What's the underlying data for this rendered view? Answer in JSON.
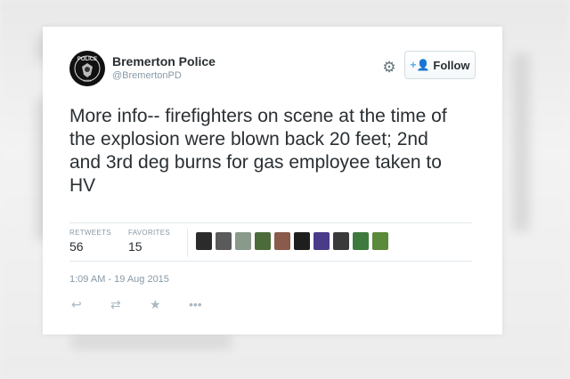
{
  "account": {
    "name": "Bremerton Police",
    "handle": "@BremertonPD",
    "avatar_icon": "police-badge-icon"
  },
  "header": {
    "settings_icon": "gear-icon",
    "follow_label": "Follow",
    "follow_icon": "add-user-icon"
  },
  "tweet": {
    "text": "More info-- firefighters on scene at the time of the explosion were blown back 20 feet; 2nd and 3rd deg burns for gas employee taken to HV",
    "timestamp": "1:09 AM - 19 Aug 2015"
  },
  "stats": {
    "retweets_label": "RETWEETS",
    "retweets_value": "56",
    "favorites_label": "FAVORITES",
    "favorites_value": "15"
  },
  "favoriters": [
    {
      "name": "favoriter-avatar-1",
      "color": "#2b2b2b"
    },
    {
      "name": "favoriter-avatar-2",
      "color": "#5a5a5a"
    },
    {
      "name": "favoriter-avatar-3",
      "color": "#8a9a8a"
    },
    {
      "name": "favoriter-avatar-4",
      "color": "#4c6b3a"
    },
    {
      "name": "favoriter-avatar-5",
      "color": "#8a5a4a"
    },
    {
      "name": "favoriter-avatar-6",
      "color": "#1e1e1e"
    },
    {
      "name": "favoriter-avatar-7",
      "color": "#4a3a8a"
    },
    {
      "name": "favoriter-avatar-8",
      "color": "#3a3a3a"
    },
    {
      "name": "favoriter-avatar-9",
      "color": "#3e7a3e"
    },
    {
      "name": "favoriter-avatar-10",
      "color": "#5a8a3a"
    }
  ],
  "actions": [
    {
      "name": "reply-icon",
      "glyph": "↩"
    },
    {
      "name": "retweet-icon",
      "glyph": "⇄"
    },
    {
      "name": "favorite-icon",
      "glyph": "★"
    },
    {
      "name": "more-icon",
      "glyph": "•••"
    }
  ],
  "colors": {
    "link_blue": "#55acee",
    "text": "#292f33",
    "muted": "#8899a6"
  }
}
